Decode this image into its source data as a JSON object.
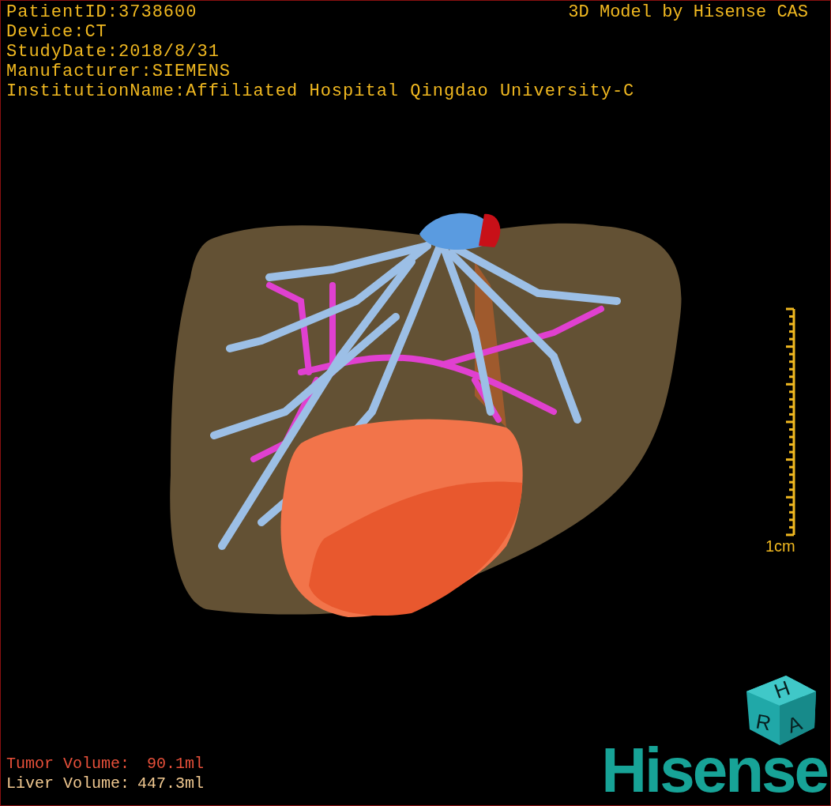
{
  "header_info": [
    "PatientID:3738600",
    "Device:CT",
    "StudyDate:2018/8/31",
    "Manufacturer:SIEMENS",
    "InstitutionName:Affiliated Hospital Qingdao University-C"
  ],
  "credit": "3D Model by Hisense CAS",
  "scale_bar": {
    "label": "1cm"
  },
  "volumes": [
    {
      "label": "Tumor Volume:",
      "value": "90.1ml",
      "color": "#e8503a"
    },
    {
      "label": "Liver Volume:",
      "value": "447.3ml",
      "color": "#f0c890"
    }
  ],
  "orientation_cube": {
    "labels": [
      "H",
      "R",
      "A"
    ]
  },
  "logo": "Hisense"
}
